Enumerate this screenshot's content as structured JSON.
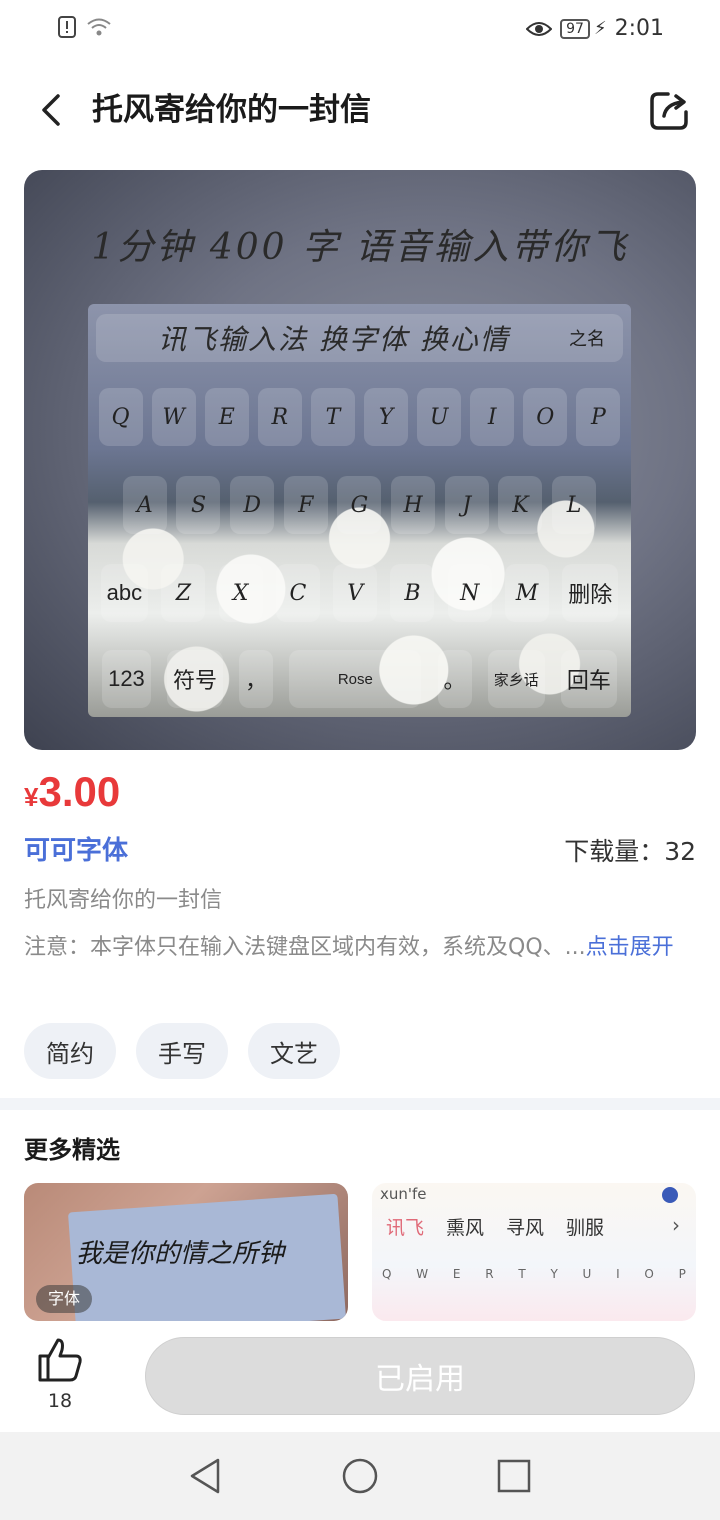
{
  "status_bar": {
    "time": "2:01",
    "battery": "97"
  },
  "header": {
    "title": "托风寄给你的一封信"
  },
  "banner": {
    "top_text": "1分钟 400 字 语音输入带你飞",
    "keyboard": {
      "bar_text": "讯飞输入法 换字体 换心情",
      "bar_right": "之名",
      "row1": [
        "Q",
        "W",
        "E",
        "R",
        "T",
        "Y",
        "U",
        "I",
        "O",
        "P"
      ],
      "row2": [
        "A",
        "S",
        "D",
        "F",
        "G",
        "H",
        "J",
        "K",
        "L"
      ],
      "row3": [
        "abc",
        "Z",
        "X",
        "C",
        "V",
        "B",
        "N",
        "M",
        "删除"
      ],
      "row4": [
        "123",
        "符号",
        "，",
        "Rose",
        "。",
        "家乡话",
        "回车"
      ]
    }
  },
  "product": {
    "currency": "¥",
    "price": "3.00",
    "author": "可可字体",
    "downloads": "下载量：32",
    "description": "托风寄给你的一封信",
    "notice": "注意：本字体只在输入法键盘区域内有效，系统及QQ、...",
    "notice_more": "点击展开",
    "tags": [
      "简约",
      "手写",
      "文艺"
    ]
  },
  "more": {
    "title": "更多精选",
    "cards": [
      {
        "text": "我是你的情之所钟",
        "badge": "字体"
      },
      {
        "top": "xun'fe",
        "words": [
          "讯飞",
          "熏风",
          "寻风",
          "驯服"
        ],
        "letters": [
          "Q",
          "W",
          "E",
          "R",
          "T",
          "Y",
          "U",
          "I",
          "O",
          "P"
        ],
        "arrow": "›"
      }
    ]
  },
  "action_bar": {
    "like_count": "18",
    "button_label": "已启用"
  },
  "colors": {
    "price": "#e8393a",
    "link": "#4a6fd8",
    "button_disabled": "#dcdcdc"
  },
  "icons": [
    "back-arrow-icon",
    "share-icon",
    "thumbs-up-icon",
    "nav-back-icon",
    "nav-home-icon",
    "nav-recent-icon",
    "eye-icon",
    "wifi-icon",
    "alert-icon"
  ]
}
